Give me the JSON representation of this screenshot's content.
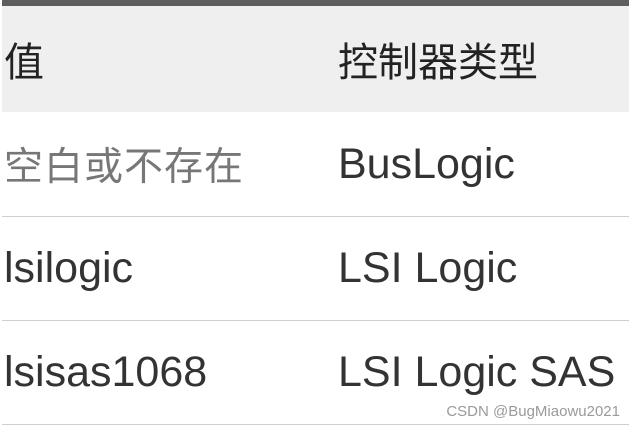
{
  "table": {
    "headers": {
      "value": "值",
      "controller_type": "控制器类型"
    },
    "rows": [
      {
        "value": "空白或不存在",
        "controller_type": "BusLogic"
      },
      {
        "value": "lsilogic",
        "controller_type": "LSI Logic"
      },
      {
        "value": "lsisas1068",
        "controller_type": "LSI Logic SAS"
      }
    ]
  },
  "watermark": "CSDN @BugMiaowu2021"
}
